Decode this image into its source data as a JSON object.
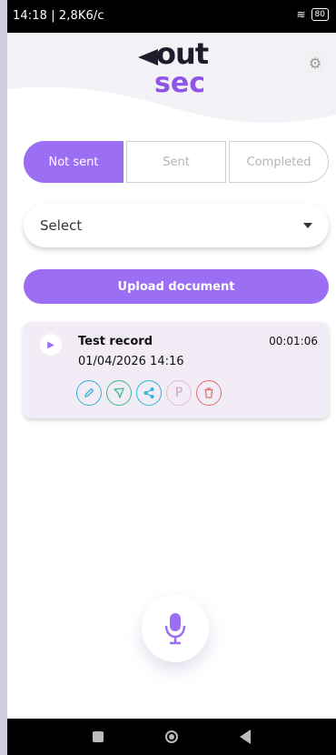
{
  "statusbar": {
    "time_net": "14:18 | 2,8K6/c",
    "battery": "80"
  },
  "logo": {
    "line1": "out",
    "line2": "sec"
  },
  "tabs": [
    {
      "label": "Not sent",
      "active": true
    },
    {
      "label": "Sent",
      "active": false
    },
    {
      "label": "Completed",
      "active": false
    }
  ],
  "select": {
    "value": "Select"
  },
  "upload": {
    "label": "Upload document"
  },
  "record": {
    "title": "Test record",
    "duration": "00:01:06",
    "datetime": "01/04/2026 14:16",
    "p_label": "P"
  },
  "colors": {
    "accent": "#9b6ef3",
    "logo_dark": "#1d1d2b",
    "logo_purple": "#8e55e8"
  },
  "icons": [
    "settings-icon",
    "chevron-down-icon",
    "play-icon",
    "edit-icon",
    "send-icon",
    "share-icon",
    "trash-icon",
    "microphone-icon"
  ]
}
